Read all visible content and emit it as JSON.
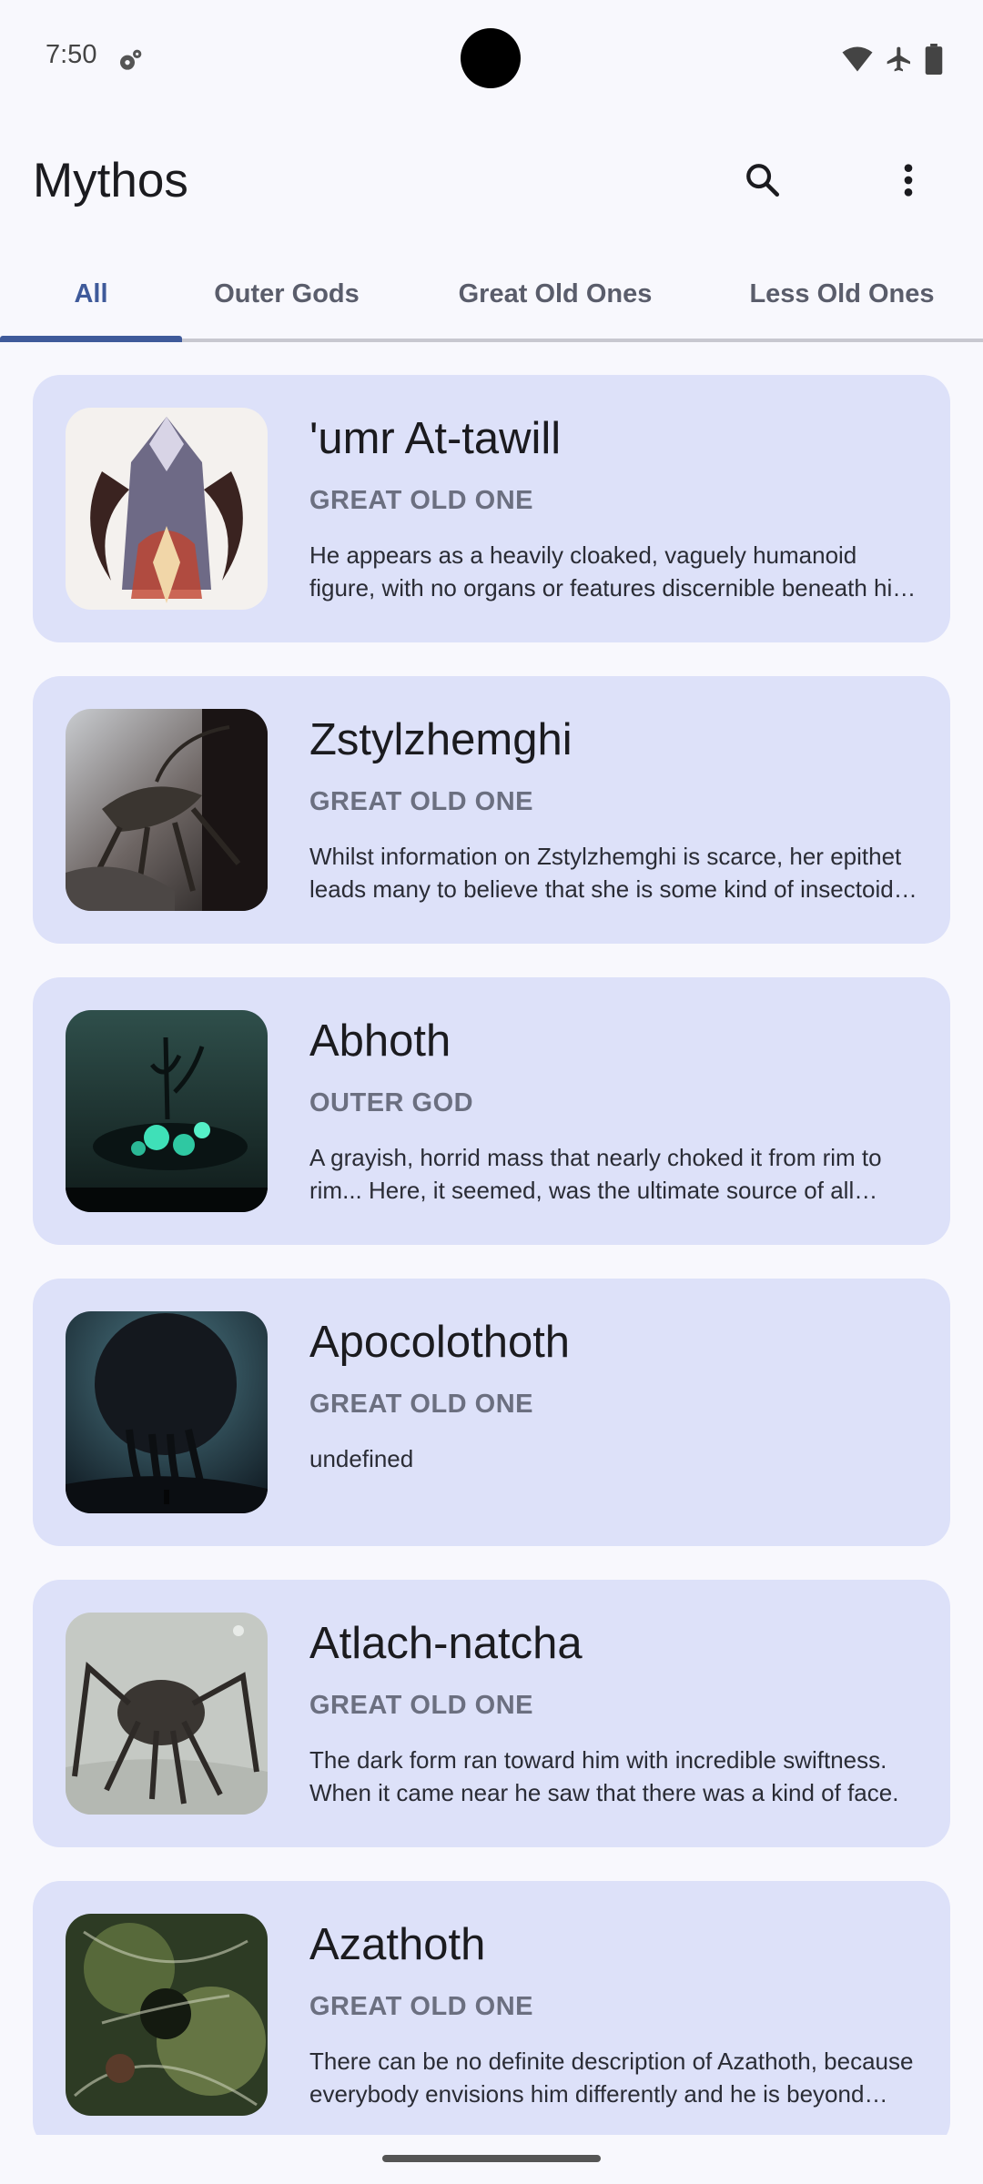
{
  "status": {
    "time": "7:50"
  },
  "app": {
    "title": "Mythos"
  },
  "tabs": [
    {
      "label": "All",
      "active": true
    },
    {
      "label": "Outer Gods",
      "active": false
    },
    {
      "label": "Great Old Ones",
      "active": false
    },
    {
      "label": "Less Old Ones",
      "active": false
    }
  ],
  "entities": [
    {
      "name": "'umr At-tawill",
      "type": "GREAT OLD ONE",
      "description": "He appears as a heavily cloaked, vaguely humanoid figure, with no organs or features discernible beneath his cloak."
    },
    {
      "name": "Zstylzhemghi",
      "type": "GREAT OLD ONE",
      "description": "Whilst information on Zstylzhemghi is scarce, her epithet leads many to believe that she is some kind of insectoid deity."
    },
    {
      "name": "Abhoth",
      "type": "OUTER GOD",
      "description": "A grayish, horrid mass that nearly choked it from rim to rim... Here, it seemed, was the ultimate source of all uncleanliness."
    },
    {
      "name": "Apocolothoth",
      "type": "GREAT OLD ONE",
      "description": "undefined"
    },
    {
      "name": "Atlach-natcha",
      "type": "GREAT OLD ONE",
      "description": "The dark form ran toward him with incredible swiftness. When it came near he saw that there was a kind of face."
    },
    {
      "name": "Azathoth",
      "type": "GREAT OLD ONE",
      "description": "There can be no definite description of Azathoth, because everybody envisions him differently and he is beyond form."
    }
  ],
  "colors": {
    "accent": "#3f5a9a",
    "card": "#dde1f9",
    "background": "#f8f8fd"
  }
}
